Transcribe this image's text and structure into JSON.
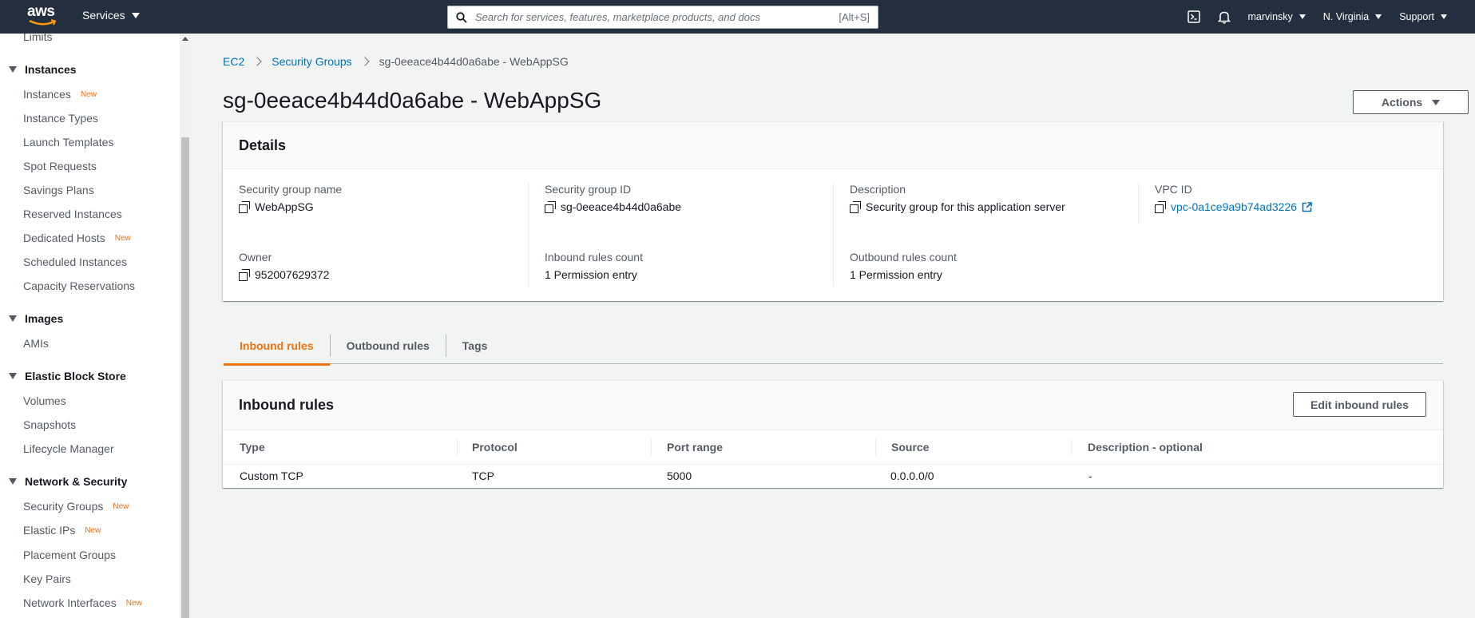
{
  "topbar": {
    "logo_text": "aws",
    "services_label": "Services",
    "search_placeholder": "Search for services, features, marketplace products, and docs",
    "search_hint": "[Alt+S]",
    "user": "marvinsky",
    "region": "N. Virginia",
    "support": "Support"
  },
  "sidebar": {
    "limits": "Limits",
    "sections": {
      "instances": "Instances",
      "images": "Images",
      "ebs": "Elastic Block Store",
      "network": "Network & Security"
    },
    "new_badge": "New",
    "items": {
      "instances": "Instances",
      "instance_types": "Instance Types",
      "launch_templates": "Launch Templates",
      "spot_requests": "Spot Requests",
      "savings_plans": "Savings Plans",
      "reserved_instances": "Reserved Instances",
      "dedicated_hosts": "Dedicated Hosts",
      "scheduled_instances": "Scheduled Instances",
      "capacity_reservations": "Capacity Reservations",
      "amis": "AMIs",
      "volumes": "Volumes",
      "snapshots": "Snapshots",
      "lifecycle_manager": "Lifecycle Manager",
      "security_groups": "Security Groups",
      "elastic_ips": "Elastic IPs",
      "placement_groups": "Placement Groups",
      "key_pairs": "Key Pairs",
      "network_interfaces": "Network Interfaces"
    }
  },
  "breadcrumb": {
    "ec2": "EC2",
    "security_groups": "Security Groups",
    "current": "sg-0eeace4b44d0a6abe - WebAppSG"
  },
  "page_title": "sg-0eeace4b44d0a6abe - WebAppSG",
  "actions_label": "Actions",
  "details": {
    "title": "Details",
    "sg_name_label": "Security group name",
    "sg_name": "WebAppSG",
    "sg_id_label": "Security group ID",
    "sg_id": "sg-0eeace4b44d0a6abe",
    "description_label": "Description",
    "description": "Security group for this application server",
    "vpc_label": "VPC ID",
    "vpc": "vpc-0a1ce9a9b74ad3226",
    "owner_label": "Owner",
    "owner": "952007629372",
    "inbound_count_label": "Inbound rules count",
    "inbound_count": "1 Permission entry",
    "outbound_count_label": "Outbound rules count",
    "outbound_count": "1 Permission entry"
  },
  "tabs": [
    "Inbound rules",
    "Outbound rules",
    "Tags"
  ],
  "inbound": {
    "title": "Inbound rules",
    "edit_label": "Edit inbound rules",
    "columns": [
      "Type",
      "Protocol",
      "Port range",
      "Source",
      "Description - optional"
    ],
    "rows": [
      [
        "Custom TCP",
        "TCP",
        "5000",
        "0.0.0.0/0",
        "-"
      ]
    ]
  },
  "colors": {
    "nav_bg": "#232f3e",
    "link": "#0073bb",
    "accent": "#ec7211",
    "new_badge": "#ec7211"
  }
}
